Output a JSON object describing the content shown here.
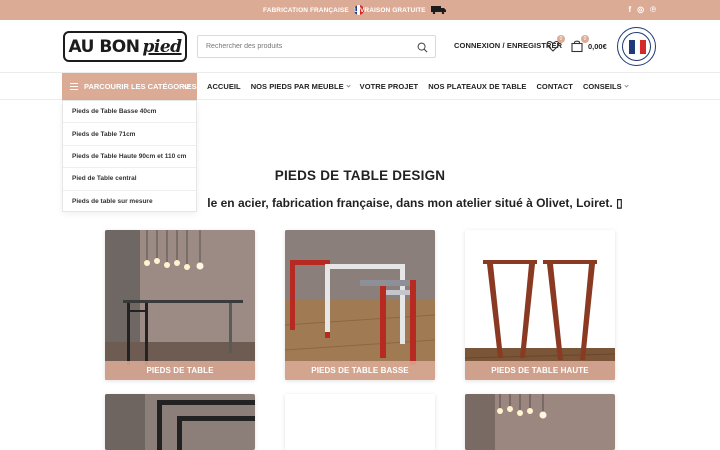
{
  "topbar": {
    "promo_fabrication": "FABRICATION FRANÇAISE",
    "promo_livraison": "LIVRAISON GRATUITE",
    "social": [
      "facebook-icon",
      "instagram-icon",
      "pinterest-icon"
    ],
    "social_glyphs": [
      "f",
      "◎",
      "℗"
    ]
  },
  "header": {
    "logo_main": "AU BON",
    "logo_accent": "pied",
    "search_placeholder": "Rechercher des produits",
    "login_label": "CONNEXION / ENREGISTRER",
    "wishlist_count": "0",
    "cart_count": "0",
    "cart_total": "0,00€"
  },
  "nav": {
    "categories_label": "PARCOURIR LES CATÉGORIES",
    "menu": [
      {
        "label": "ACCUEIL",
        "has_dropdown": false
      },
      {
        "label": "NOS PIEDS PAR MEUBLE",
        "has_dropdown": true
      },
      {
        "label": "VOTRE PROJET",
        "has_dropdown": false
      },
      {
        "label": "NOS PLATEAUX DE TABLE",
        "has_dropdown": false
      },
      {
        "label": "CONTACT",
        "has_dropdown": false
      },
      {
        "label": "CONSEILS",
        "has_dropdown": true
      }
    ]
  },
  "dropdown": {
    "items": [
      "Pieds de Table Basse 40cm",
      "Pieds de Table 71cm",
      "Pieds de Table Haute 90cm et 110 cm",
      "Pied de Table central",
      "Pieds de table sur mesure"
    ]
  },
  "main": {
    "title": "PIEDS DE TABLE DESIGN",
    "subtitle": "le en acier, fabrication française, dans mon atelier situé à Olivet, Loiret. ▯",
    "categories": [
      {
        "label": "PIEDS DE TABLE"
      },
      {
        "label": "PIEDS DE TABLE BASSE"
      },
      {
        "label": "PIEDS DE TABLE HAUTE"
      }
    ]
  },
  "colors": {
    "accent": "#dbab96",
    "text": "#222222",
    "seal_blue": "#1f3a78",
    "seal_red": "#d62828"
  }
}
